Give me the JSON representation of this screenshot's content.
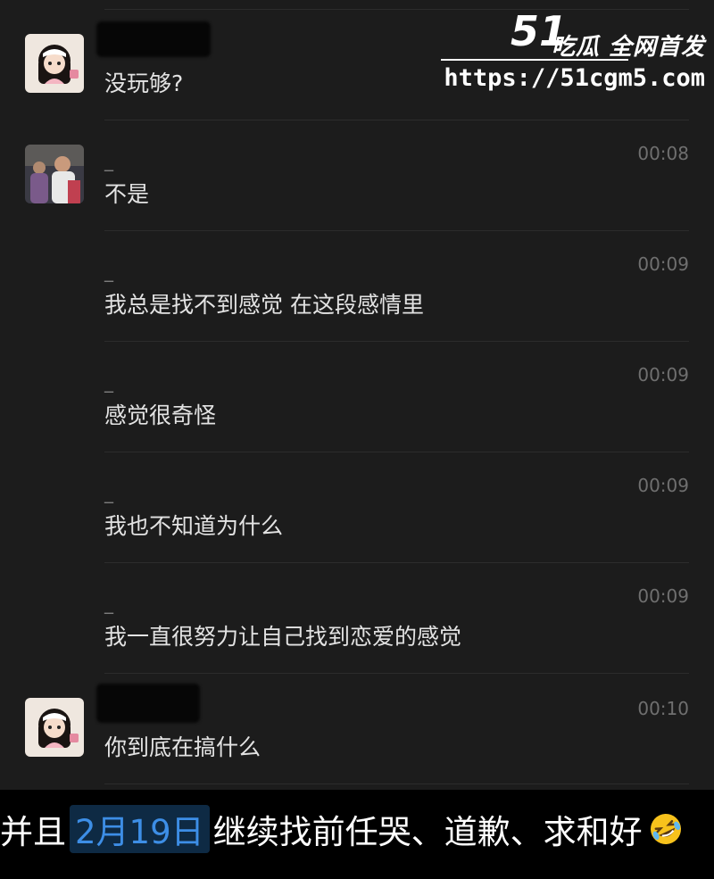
{
  "watermark": {
    "logo": "51",
    "title": "吃瓜 全网首发",
    "url": "https://51cgm5.com"
  },
  "messages": [
    {
      "sender": "",
      "time": "",
      "text": "没玩够?",
      "avatar": "girl-avatar"
    },
    {
      "sender": "_",
      "time": "00:08",
      "text": "不是",
      "avatar": "photo-avatar"
    },
    {
      "sender": "_",
      "time": "00:09",
      "text": "我总是找不到感觉 在这段感情里"
    },
    {
      "sender": "_",
      "time": "00:09",
      "text": "感觉很奇怪"
    },
    {
      "sender": "_",
      "time": "00:09",
      "text": "我也不知道为什么"
    },
    {
      "sender": "_",
      "time": "00:09",
      "text": "我一直很努力让自己找到恋爱的感觉"
    },
    {
      "sender": "",
      "time": "00:10",
      "text": "你到底在搞什么",
      "avatar": "girl-avatar"
    }
  ],
  "caption": {
    "before": "并且",
    "date": "2月19日",
    "after": "继续找前任哭、道歉、求和好",
    "emoji": "rolling-laughing-emoji"
  }
}
